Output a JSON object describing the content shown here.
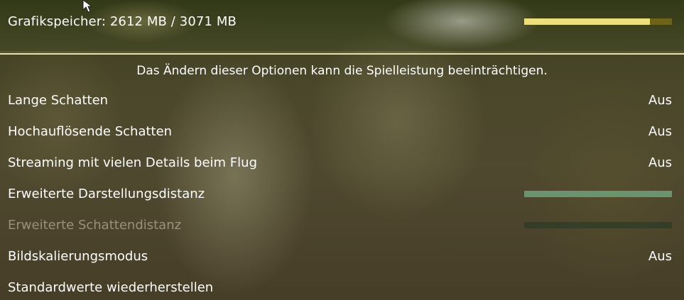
{
  "vram": {
    "label": "Grafikspeicher: 2612 MB / 3071 MB",
    "used_mb": 2612,
    "total_mb": 3071,
    "used_fraction": 0.85
  },
  "warning": "Das Ändern dieser Optionen kann die Spielleistung beeinträchtigen.",
  "settings": [
    {
      "label": "Lange Schatten",
      "value": "Aus",
      "type": "toggle",
      "enabled": true
    },
    {
      "label": "Hochauflösende Schatten",
      "value": "Aus",
      "type": "toggle",
      "enabled": true
    },
    {
      "label": "Streaming mit vielen Details beim Flug",
      "value": "Aus",
      "type": "toggle",
      "enabled": true
    },
    {
      "label": "Erweiterte Darstellungsdistanz",
      "type": "slider",
      "level": 1.0,
      "enabled": true
    },
    {
      "label": "Erweiterte Schattendistanz",
      "type": "slider",
      "level": 1.0,
      "enabled": false
    },
    {
      "label": "Bildskalierungsmodus",
      "value": "Aus",
      "type": "toggle",
      "enabled": true
    },
    {
      "label": "Standardwerte wiederherstellen",
      "type": "action",
      "enabled": true
    }
  ],
  "colors": {
    "vram_fill": "#ece07a",
    "vram_track": "#6e6418",
    "slider_fill": "#6a9470",
    "divider": "#e9dfac"
  },
  "icons": {
    "cursor": "mouse-pointer-icon"
  }
}
